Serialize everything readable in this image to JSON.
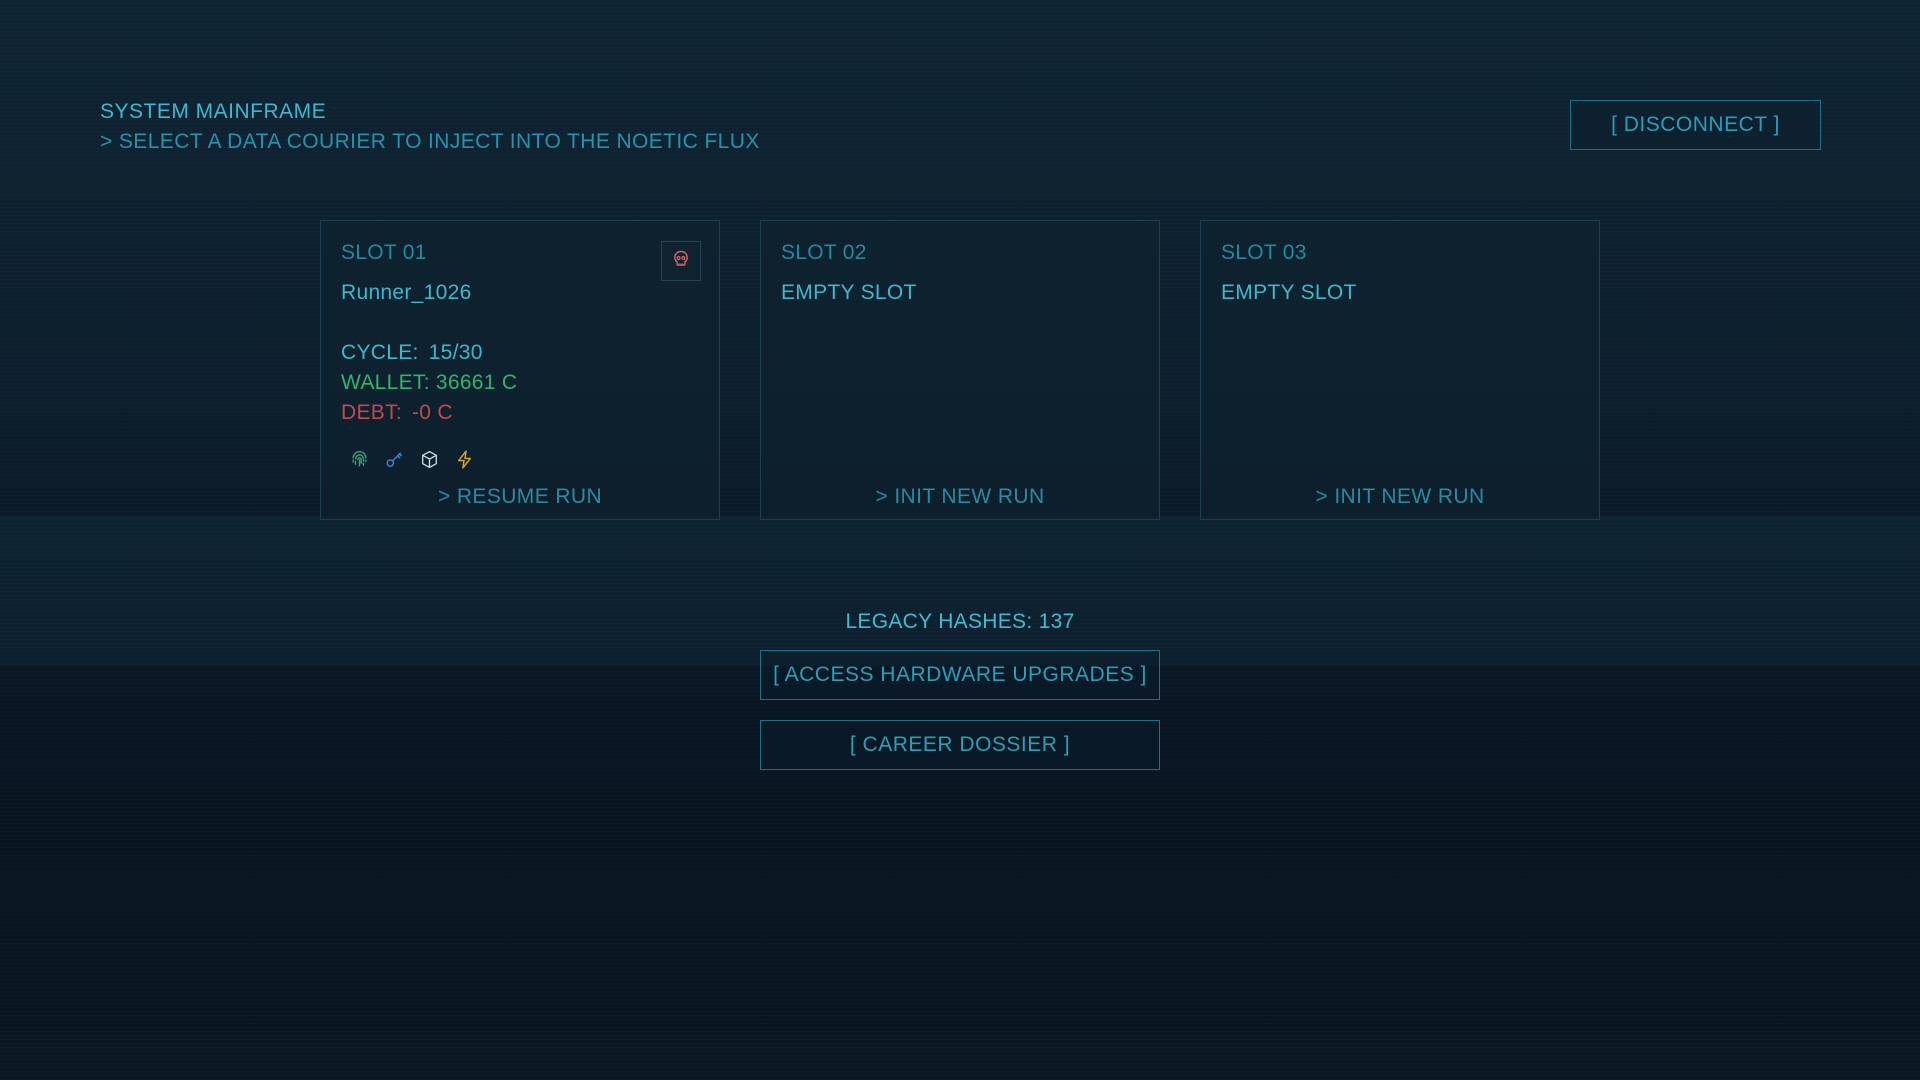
{
  "header": {
    "title": "SYSTEM MAINFRAME",
    "subtitle": "> SELECT A DATA COURIER TO INJECT INTO THE NOETIC FLUX"
  },
  "disconnect_label": "[ DISCONNECT ]",
  "slots": [
    {
      "label": "SLOT 01",
      "name": "Runner_1026",
      "cycle_label": "CYCLE:",
      "cycle_value": "15/30",
      "wallet_label": "WALLET:",
      "wallet_value": "36661 C",
      "debt_label": "DEBT:",
      "debt_value": "-0 C",
      "action": "> RESUME RUN",
      "delete_icon": "skull-icon",
      "status_icons": [
        "fingerprint-icon",
        "key-icon",
        "cube-icon",
        "lightning-icon"
      ]
    },
    {
      "label": "SLOT 02",
      "name": "EMPTY SLOT",
      "action": "> INIT NEW RUN"
    },
    {
      "label": "SLOT 03",
      "name": "EMPTY SLOT",
      "action": "> INIT NEW RUN"
    }
  ],
  "legacy": {
    "label": "LEGACY HASHES: 137"
  },
  "upgrades_label": "[ ACCESS HARDWARE UPGRADES ]",
  "dossier_label": "[ CAREER DOSSIER ]",
  "colors": {
    "accent": "#2aa3b8",
    "wallet": "#32b36e",
    "debt": "#c5484f",
    "skull": "#d9626a",
    "fingerprint": "#2fae7a",
    "key": "#3f7fd6",
    "cube": "#c9d4dc",
    "lightning": "#d9a627"
  }
}
